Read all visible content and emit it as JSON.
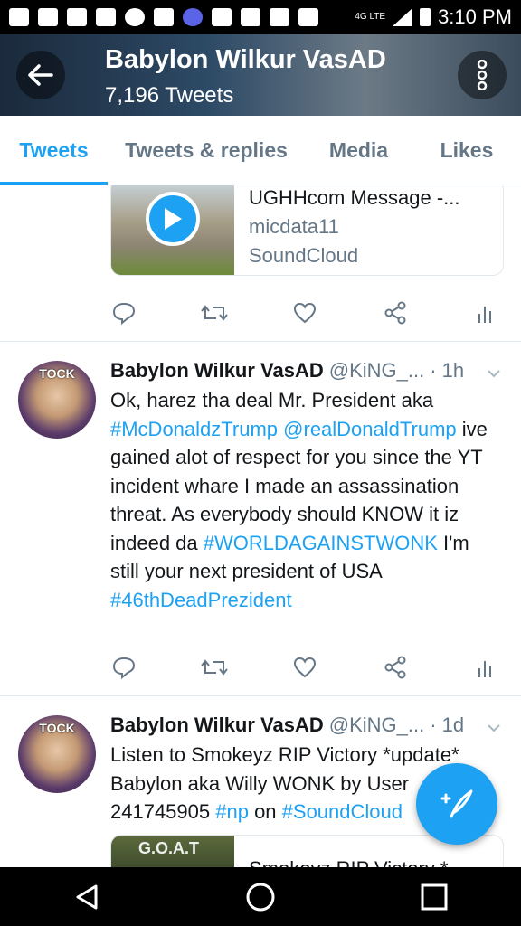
{
  "status_bar": {
    "time": "3:10 PM",
    "network": "4G LTE"
  },
  "header": {
    "title": "Babylon Wilkur VasAD",
    "tweet_count": "7,196 Tweets"
  },
  "tabs": [
    {
      "label": "Tweets",
      "active": true
    },
    {
      "label": "Tweets & replies",
      "active": false
    },
    {
      "label": "Media",
      "active": false
    },
    {
      "label": "Likes",
      "active": false
    }
  ],
  "tweets": [
    {
      "card": {
        "title": "UGHHcom Message -...",
        "author": "micdata11",
        "source": "SoundCloud"
      }
    },
    {
      "avatar_text": "TOCK",
      "name": "Babylon Wilkur VasAD",
      "handle": "@KiNG_...",
      "time": "· 1h",
      "body_parts": [
        {
          "text": "Ok, harez tha deal Mr. President aka ",
          "link": false
        },
        {
          "text": "#McDonaldzTrump",
          "link": true
        },
        {
          "text": " ",
          "link": false
        },
        {
          "text": "@realDonaldTrump",
          "link": true
        },
        {
          "text": " ive gained alot of respect for you since the YT incident whare I made an assassination threat. As everybody should KNOW it iz indeed da ",
          "link": false
        },
        {
          "text": "#WORLDAGAINSTWONK",
          "link": true
        },
        {
          "text": " I'm still your next president of USA ",
          "link": false
        },
        {
          "text": "#46thDeadPrezident",
          "link": true
        }
      ]
    },
    {
      "avatar_text": "TOCK",
      "name": "Babylon Wilkur VasAD",
      "handle": "@KiNG_...",
      "time": "· 1d",
      "body_parts": [
        {
          "text": "Listen to Smokeyz RIP Victory *update* Babylon aka Willy WONK by User 241745905 ",
          "link": false
        },
        {
          "text": "#np",
          "link": true
        },
        {
          "text": " on ",
          "link": false
        },
        {
          "text": "#SoundCloud",
          "link": true
        }
      ],
      "card": {
        "thumb_text": "G.O.A.T",
        "title": "Smokeyz RIP Victory *"
      }
    }
  ],
  "colors": {
    "accent": "#1da1f2",
    "secondary_text": "#657786",
    "primary_text": "#14171a"
  },
  "icons": [
    "back-arrow-icon",
    "more-vert-icon",
    "reply-icon",
    "retweet-icon",
    "like-icon",
    "share-icon",
    "analytics-icon",
    "chevron-down-icon",
    "compose-icon",
    "nav-back-icon",
    "nav-home-icon",
    "nav-recents-icon"
  ]
}
